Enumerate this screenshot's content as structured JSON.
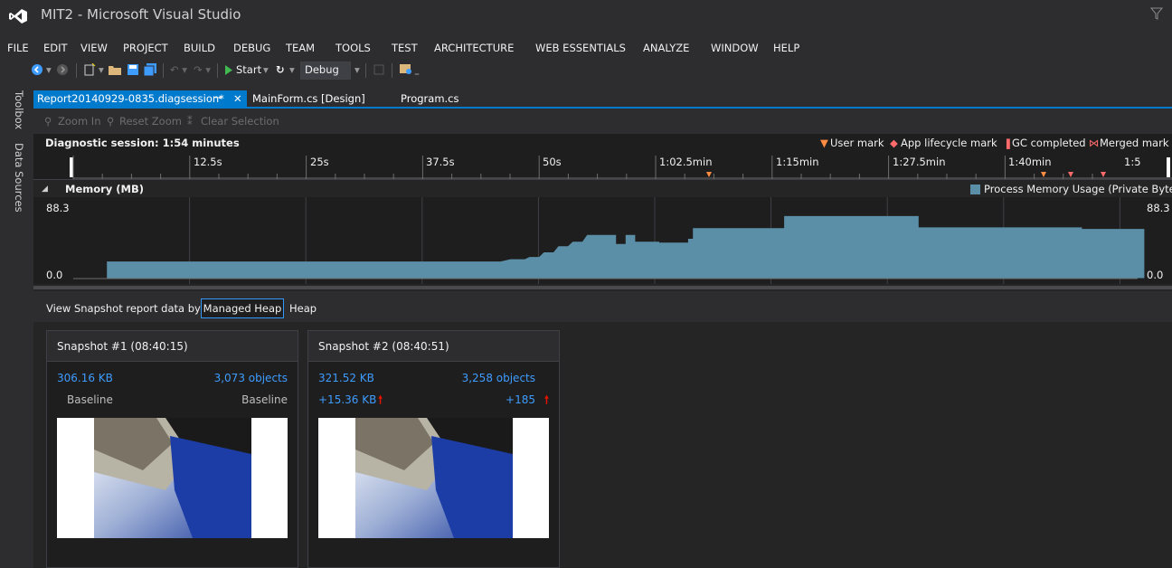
{
  "window": {
    "title": "MIT2 - Microsoft Visual Studio"
  },
  "menu": [
    "FILE",
    "EDIT",
    "VIEW",
    "PROJECT",
    "BUILD",
    "DEBUG",
    "TEAM",
    "TOOLS",
    "TEST",
    "ARCHITECTURE",
    "WEB ESSENTIALS",
    "ANALYZE",
    "WINDOW",
    "HELP"
  ],
  "toolbar": {
    "start_label": "Start",
    "config_value": "Debug"
  },
  "side_tabs": [
    "Toolbox",
    "Data Sources"
  ],
  "tabs": [
    {
      "label": "Report20140929-0835.diagsession*",
      "active": true
    },
    {
      "label": "MainForm.cs [Design]",
      "active": false
    },
    {
      "label": "Program.cs",
      "active": false
    }
  ],
  "zoom_toolbar": {
    "zoom_in": "Zoom In",
    "reset_zoom": "Reset Zoom",
    "clear_selection": "Clear Selection"
  },
  "session": {
    "title": "Diagnostic session: 1:54 minutes",
    "legend": [
      "User mark",
      "App lifecycle mark",
      "GC completed",
      "Merged mark"
    ]
  },
  "ruler": {
    "ticks": [
      "12.5s",
      "25s",
      "37.5s",
      "50s",
      "1:02.5min",
      "1:15min",
      "1:27.5min",
      "1:40min",
      "1:5"
    ]
  },
  "memory": {
    "title": "Memory (MB)",
    "legend": "Process Memory Usage (Private Bytes)",
    "y_max": "88.3",
    "y_min": "0.0"
  },
  "chart_data": {
    "type": "area",
    "title": "Memory (MB)",
    "ylabel": "",
    "ylim": [
      0.0,
      88.3
    ],
    "xlim": [
      0,
      114
    ],
    "series": [
      {
        "name": "Process Memory Usage (Private Bytes)",
        "points": [
          [
            3.5,
            0
          ],
          [
            3.5,
            22
          ],
          [
            44.5,
            22
          ],
          [
            45.5,
            25
          ],
          [
            47,
            25
          ],
          [
            47.5,
            28
          ],
          [
            48.5,
            28
          ],
          [
            49,
            34
          ],
          [
            50,
            34
          ],
          [
            50.5,
            42
          ],
          [
            51.5,
            42
          ],
          [
            52,
            48
          ],
          [
            53,
            48
          ],
          [
            53.5,
            57
          ],
          [
            55,
            57
          ],
          [
            55.5,
            57
          ],
          [
            56.5,
            57
          ],
          [
            56.5,
            45
          ],
          [
            57.5,
            45
          ],
          [
            57.5,
            57
          ],
          [
            58.5,
            57
          ],
          [
            58.5,
            48
          ],
          [
            61,
            48
          ],
          [
            61,
            47
          ],
          [
            64,
            47
          ],
          [
            64,
            52
          ],
          [
            64.5,
            52
          ],
          [
            64.5,
            66
          ],
          [
            74,
            66
          ],
          [
            74,
            82
          ],
          [
            88,
            82
          ],
          [
            88,
            67
          ],
          [
            105,
            67
          ],
          [
            105,
            65
          ],
          [
            111.5,
            65
          ],
          [
            111.5,
            0
          ]
        ],
        "unit": "MB"
      }
    ]
  },
  "snapshot_view": {
    "label": "View Snapshot report data by:",
    "options": [
      "Managed Heap",
      "Heap"
    ],
    "selected": "Managed Heap"
  },
  "snapshots": [
    {
      "title": "Snapshot #1  (08:40:15)",
      "size": "306.16 KB",
      "objects": "3,073 objects",
      "size_diff": "Baseline",
      "objects_diff": "Baseline"
    },
    {
      "title": "Snapshot #2  (08:40:51)",
      "size": "321.52 KB",
      "objects": "3,258 objects",
      "size_diff": "+15.36 KB",
      "objects_diff": "+185"
    }
  ],
  "colors": {
    "accent": "#007acc",
    "chart_fill": "#5b8ea7",
    "link_blue": "#3e9cff",
    "up_arrow": "#e51400",
    "user_mark": "#ff8c42",
    "lifecycle_mark": "#ff6b6b",
    "gc_mark": "#ff6b6b"
  },
  "icons": [
    "vs-logo-icon",
    "filter-icon",
    "back-icon",
    "forward-icon",
    "new-project-icon",
    "open-icon",
    "save-icon",
    "save-all-icon",
    "undo-icon",
    "redo-icon",
    "start-icon",
    "restart-icon",
    "pin-icon",
    "close-icon",
    "zoom-in-icon",
    "reset-zoom-icon",
    "clear-selection-icon",
    "up-arrow-icon"
  ]
}
